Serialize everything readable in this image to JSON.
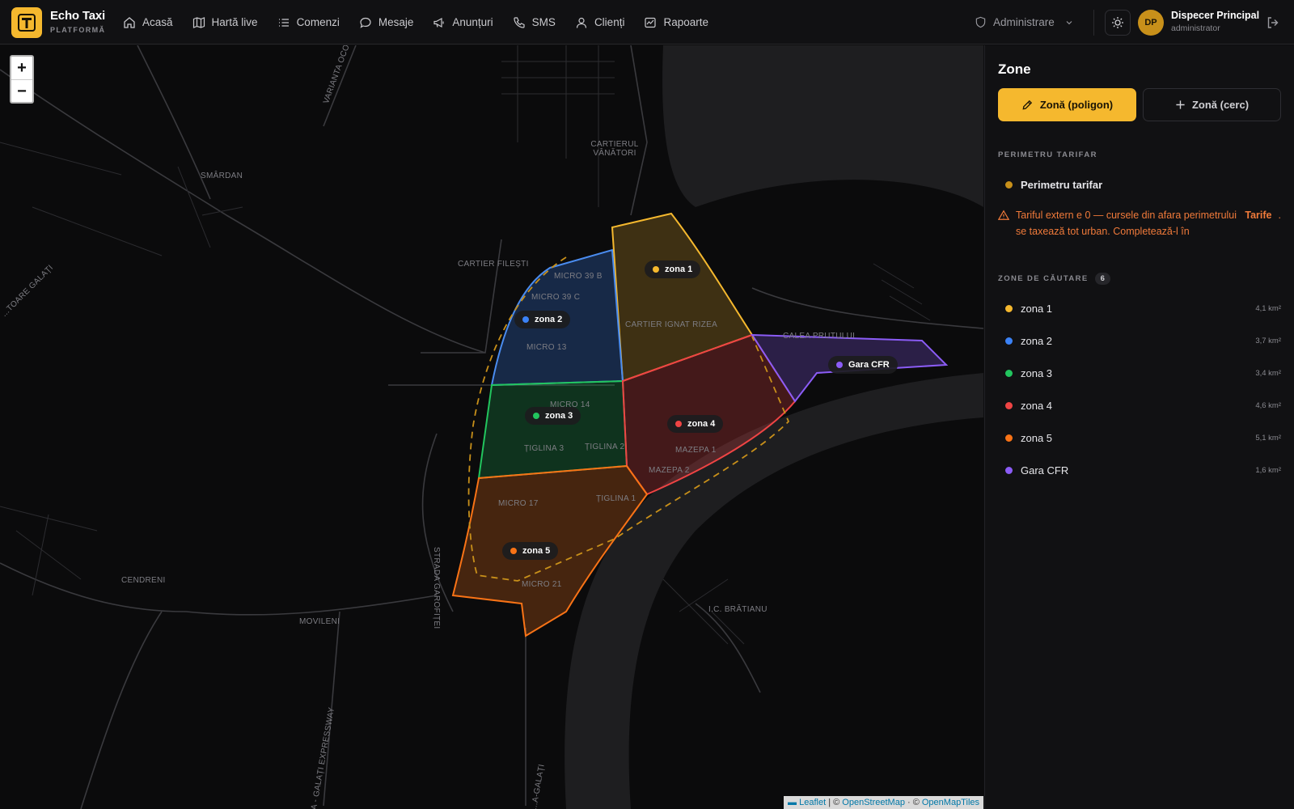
{
  "brand": {
    "name": "Echo Taxi",
    "subtitle": "PLATFORMĂ"
  },
  "nav": [
    {
      "label": "Acasă",
      "icon": "home-icon"
    },
    {
      "label": "Hartă live",
      "icon": "map-icon"
    },
    {
      "label": "Comenzi",
      "icon": "list-icon"
    },
    {
      "label": "Mesaje",
      "icon": "chat-icon"
    },
    {
      "label": "Anunțuri",
      "icon": "megaphone-icon"
    },
    {
      "label": "SMS",
      "icon": "phone-icon"
    },
    {
      "label": "Clienți",
      "icon": "user-icon"
    },
    {
      "label": "Rapoarte",
      "icon": "chart-icon"
    }
  ],
  "admin": {
    "label": "Administrare"
  },
  "user": {
    "initials": "DP",
    "name": "Dispecer Principal",
    "role": "administrator"
  },
  "map": {
    "zoom_in": "+",
    "zoom_out": "−",
    "places": [
      "SMÂRDAN",
      "VARIANTA OCOLIT...",
      "CARTIERUL VÂNĂTORI",
      "CARTIER FILEȘTI",
      "MICRO 39 B",
      "MICRO 39 C",
      "CARTIER IGNAT RIZEA",
      "MICRO 13",
      "MICRO 14",
      "CALEA PRUTULUI",
      "ȚIGLINA 3",
      "ȚIGLINA 2",
      "MAZEPA 1",
      "MAZEPA 2",
      "STRADA GAROFIȚEI",
      "ȚIGLINA 1",
      "MICRO 17",
      "MICRO 21",
      "CENDRENI",
      "MOVILENI",
      "I.C. BRĂTIANU",
      "...TOARE GALAȚI",
      "A - GALAȚI EXPRESSWAY",
      "...A-GALAȚI"
    ],
    "zone_labels": [
      "zona 1",
      "zona 2",
      "zona 3",
      "zona 4",
      "zona 5",
      "Gara CFR"
    ],
    "attribution": {
      "leaflet": "Leaflet",
      "sep1": " | © ",
      "osm": "OpenStreetMap",
      "sep2": " · © ",
      "omt": "OpenMapTiles"
    }
  },
  "panel": {
    "title": "Zone",
    "btn_polygon": "Zonă (poligon)",
    "btn_circle": "Zonă (cerc)",
    "perimeter_section": "PERIMETRU TARIFAR",
    "perimeter_item": "Perimetru tarifar",
    "warning": "Tariful extern e 0 — cursele din afara perimetrului se taxează tot urban. Completează-l în",
    "warning_link": "Tarife",
    "warning_end": ".",
    "zones_section": "ZONE DE CĂUTARE",
    "zones_count": "6",
    "zones": [
      {
        "name": "zona 1",
        "area": "4,1 km²",
        "color": "#f5b82e"
      },
      {
        "name": "zona 2",
        "area": "3,7 km²",
        "color": "#3b82f6"
      },
      {
        "name": "zona 3",
        "area": "3,4 km²",
        "color": "#22c55e"
      },
      {
        "name": "zona 4",
        "area": "4,6 km²",
        "color": "#ef4444"
      },
      {
        "name": "zona 5",
        "area": "5,1 km²",
        "color": "#f97316"
      },
      {
        "name": "Gara CFR",
        "area": "1,6 km²",
        "color": "#8b5cf6"
      }
    ]
  },
  "colors": {
    "accent": "#f5b82e",
    "perimeter": "#c8901a",
    "warning": "#f07a3a"
  }
}
